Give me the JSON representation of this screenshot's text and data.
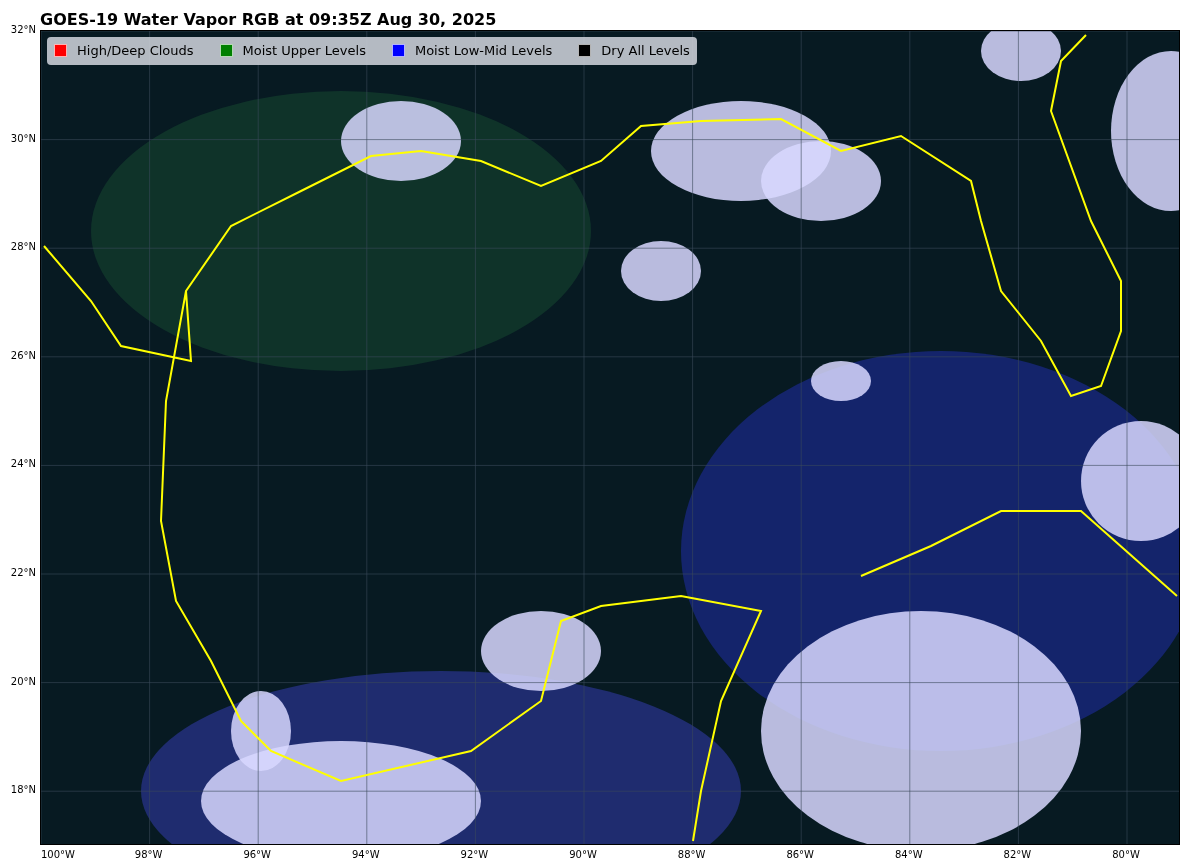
{
  "title": "GOES-19 Water Vapor RGB at 09:35Z Aug 30, 2025",
  "legend": [
    {
      "label": "High/Deep Clouds",
      "color": "#ff0000"
    },
    {
      "label": "Moist Upper Levels",
      "color": "#008000"
    },
    {
      "label": "Moist Low-Mid Levels",
      "color": "#0000ff"
    },
    {
      "label": "Dry All Levels",
      "color": "#000000"
    }
  ],
  "lat_ticks": [
    "32°N",
    "30°N",
    "28°N",
    "26°N",
    "24°N",
    "22°N",
    "20°N",
    "18°N"
  ],
  "lon_ticks": [
    "100°W",
    "98°W",
    "96°W",
    "94°W",
    "92°W",
    "90°W",
    "88°W",
    "86°W",
    "84°W",
    "82°W",
    "80°W"
  ]
}
